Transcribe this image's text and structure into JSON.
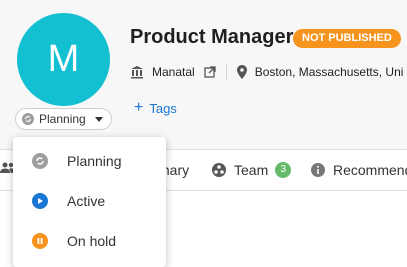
{
  "job": {
    "avatar_letter": "M",
    "title": "Product Manager",
    "publish_badge": "NOT PUBLISHED",
    "company": "Manatal",
    "location": "Boston, Massachusetts, Uni",
    "tags_link": "Tags"
  },
  "status_selector": {
    "current": "Planning"
  },
  "status_menu": {
    "items": [
      {
        "label": "Planning",
        "icon": "sync-icon",
        "color": "#9e9e9e"
      },
      {
        "label": "Active",
        "icon": "play-icon",
        "color": "#1976d2"
      },
      {
        "label": "On hold",
        "icon": "pause-icon",
        "color": "#f7941d"
      }
    ]
  },
  "tabs": [
    {
      "label": "mary",
      "icon": "summary-icon"
    },
    {
      "label": "Team",
      "icon": "team-icon",
      "count": "3"
    },
    {
      "label": "Recommend",
      "icon": "info-icon"
    }
  ],
  "colors": {
    "accent": "#12c0d1",
    "badge": "#f7941d",
    "link": "#1976d2",
    "count_badge": "#66bb6a"
  }
}
